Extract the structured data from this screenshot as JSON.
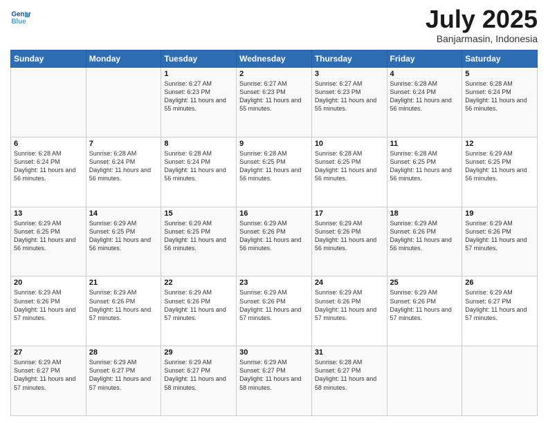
{
  "header": {
    "logo_line1": "General",
    "logo_line2": "Blue",
    "month": "July 2025",
    "location": "Banjarmasin, Indonesia"
  },
  "weekdays": [
    "Sunday",
    "Monday",
    "Tuesday",
    "Wednesday",
    "Thursday",
    "Friday",
    "Saturday"
  ],
  "weeks": [
    [
      {
        "day": "",
        "info": ""
      },
      {
        "day": "",
        "info": ""
      },
      {
        "day": "1",
        "info": "Sunrise: 6:27 AM\nSunset: 6:23 PM\nDaylight: 11 hours and 55 minutes."
      },
      {
        "day": "2",
        "info": "Sunrise: 6:27 AM\nSunset: 6:23 PM\nDaylight: 11 hours and 55 minutes."
      },
      {
        "day": "3",
        "info": "Sunrise: 6:27 AM\nSunset: 6:23 PM\nDaylight: 11 hours and 55 minutes."
      },
      {
        "day": "4",
        "info": "Sunrise: 6:28 AM\nSunset: 6:24 PM\nDaylight: 11 hours and 56 minutes."
      },
      {
        "day": "5",
        "info": "Sunrise: 6:28 AM\nSunset: 6:24 PM\nDaylight: 11 hours and 56 minutes."
      }
    ],
    [
      {
        "day": "6",
        "info": "Sunrise: 6:28 AM\nSunset: 6:24 PM\nDaylight: 11 hours and 56 minutes."
      },
      {
        "day": "7",
        "info": "Sunrise: 6:28 AM\nSunset: 6:24 PM\nDaylight: 11 hours and 56 minutes."
      },
      {
        "day": "8",
        "info": "Sunrise: 6:28 AM\nSunset: 6:24 PM\nDaylight: 11 hours and 56 minutes."
      },
      {
        "day": "9",
        "info": "Sunrise: 6:28 AM\nSunset: 6:25 PM\nDaylight: 11 hours and 56 minutes."
      },
      {
        "day": "10",
        "info": "Sunrise: 6:28 AM\nSunset: 6:25 PM\nDaylight: 11 hours and 56 minutes."
      },
      {
        "day": "11",
        "info": "Sunrise: 6:28 AM\nSunset: 6:25 PM\nDaylight: 11 hours and 56 minutes."
      },
      {
        "day": "12",
        "info": "Sunrise: 6:29 AM\nSunset: 6:25 PM\nDaylight: 11 hours and 56 minutes."
      }
    ],
    [
      {
        "day": "13",
        "info": "Sunrise: 6:29 AM\nSunset: 6:25 PM\nDaylight: 11 hours and 56 minutes."
      },
      {
        "day": "14",
        "info": "Sunrise: 6:29 AM\nSunset: 6:25 PM\nDaylight: 11 hours and 56 minutes."
      },
      {
        "day": "15",
        "info": "Sunrise: 6:29 AM\nSunset: 6:25 PM\nDaylight: 11 hours and 56 minutes."
      },
      {
        "day": "16",
        "info": "Sunrise: 6:29 AM\nSunset: 6:26 PM\nDaylight: 11 hours and 56 minutes."
      },
      {
        "day": "17",
        "info": "Sunrise: 6:29 AM\nSunset: 6:26 PM\nDaylight: 11 hours and 56 minutes."
      },
      {
        "day": "18",
        "info": "Sunrise: 6:29 AM\nSunset: 6:26 PM\nDaylight: 11 hours and 56 minutes."
      },
      {
        "day": "19",
        "info": "Sunrise: 6:29 AM\nSunset: 6:26 PM\nDaylight: 11 hours and 57 minutes."
      }
    ],
    [
      {
        "day": "20",
        "info": "Sunrise: 6:29 AM\nSunset: 6:26 PM\nDaylight: 11 hours and 57 minutes."
      },
      {
        "day": "21",
        "info": "Sunrise: 6:29 AM\nSunset: 6:26 PM\nDaylight: 11 hours and 57 minutes."
      },
      {
        "day": "22",
        "info": "Sunrise: 6:29 AM\nSunset: 6:26 PM\nDaylight: 11 hours and 57 minutes."
      },
      {
        "day": "23",
        "info": "Sunrise: 6:29 AM\nSunset: 6:26 PM\nDaylight: 11 hours and 57 minutes."
      },
      {
        "day": "24",
        "info": "Sunrise: 6:29 AM\nSunset: 6:26 PM\nDaylight: 11 hours and 57 minutes."
      },
      {
        "day": "25",
        "info": "Sunrise: 6:29 AM\nSunset: 6:26 PM\nDaylight: 11 hours and 57 minutes."
      },
      {
        "day": "26",
        "info": "Sunrise: 6:29 AM\nSunset: 6:27 PM\nDaylight: 11 hours and 57 minutes."
      }
    ],
    [
      {
        "day": "27",
        "info": "Sunrise: 6:29 AM\nSunset: 6:27 PM\nDaylight: 11 hours and 57 minutes."
      },
      {
        "day": "28",
        "info": "Sunrise: 6:29 AM\nSunset: 6:27 PM\nDaylight: 11 hours and 57 minutes."
      },
      {
        "day": "29",
        "info": "Sunrise: 6:29 AM\nSunset: 6:27 PM\nDaylight: 11 hours and 58 minutes."
      },
      {
        "day": "30",
        "info": "Sunrise: 6:29 AM\nSunset: 6:27 PM\nDaylight: 11 hours and 58 minutes."
      },
      {
        "day": "31",
        "info": "Sunrise: 6:28 AM\nSunset: 6:27 PM\nDaylight: 11 hours and 58 minutes."
      },
      {
        "day": "",
        "info": ""
      },
      {
        "day": "",
        "info": ""
      }
    ]
  ]
}
